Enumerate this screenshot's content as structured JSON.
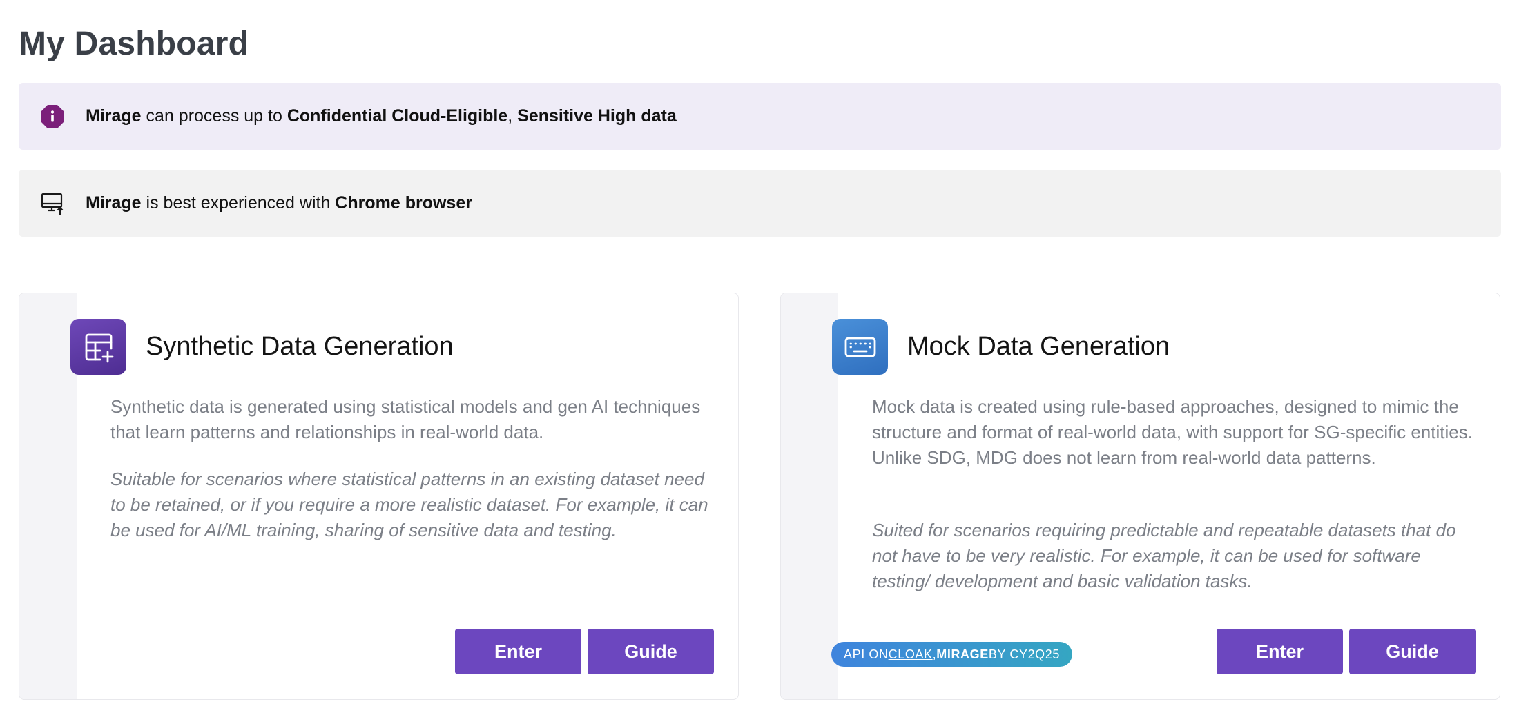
{
  "page": {
    "title": "My Dashboard"
  },
  "banners": {
    "info": {
      "app": "Mirage",
      "text_mid": " can process up to ",
      "level1": "Confidential Cloud-Eligible",
      "sep": ", ",
      "level2": "Sensitive High data",
      "icon": "info-octagon-icon",
      "icon_color": "#7b1f7a"
    },
    "browser": {
      "app": "Mirage",
      "text_mid": " is best experienced with ",
      "browser": "Chrome browser",
      "icon": "monitor-upload-icon"
    }
  },
  "cards": {
    "synthetic": {
      "icon": "table-plus-icon",
      "title": "Synthetic Data Generation",
      "description": "Synthetic data is generated using statistical models and gen AI techniques that learn patterns and relationships in real-world data.",
      "use_case": "Suitable for scenarios where statistical patterns in an existing dataset need to be retained, or if you require a more realistic dataset. For example, it can be used for AI/ML training, sharing of sensitive data and testing.",
      "enter_label": "Enter",
      "guide_label": "Guide"
    },
    "mock": {
      "icon": "keyboard-icon",
      "title": "Mock Data Generation",
      "description": "Mock data is created using rule-based approaches, designed to mimic the structure and format of real-world data, with support for SG-specific entities. Unlike SDG, MDG does not learn from real-world data patterns.",
      "use_case": "Suited for scenarios requiring predictable and repeatable datasets that do not have to be very realistic. For example, it can be used for software testing/ development and basic validation tasks.",
      "enter_label": "Enter",
      "guide_label": "Guide"
    }
  },
  "badge": {
    "prefix": "API ON ",
    "link": "CLOAK",
    "comma": ", ",
    "app": "MIRAGE",
    "by": " BY CY2Q25"
  },
  "colors": {
    "primary_button": "#6c47bf",
    "info_banner_bg": "#efecf7",
    "browser_banner_bg": "#f2f2f2"
  }
}
